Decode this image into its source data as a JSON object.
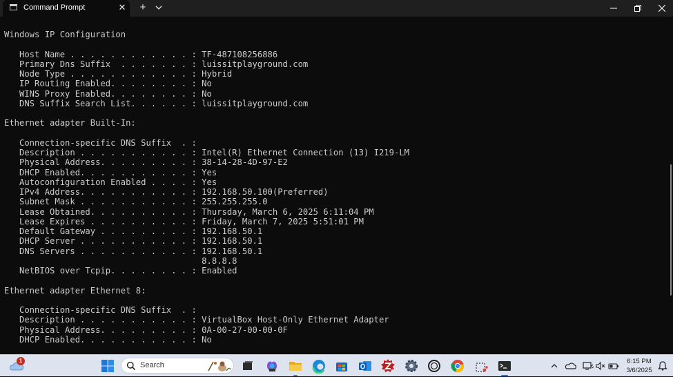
{
  "window": {
    "tab_title": "Command Prompt",
    "tab_close_glyph": "✕",
    "new_tab_glyph": "+",
    "dropdown_icon": "chevron-down-icon",
    "controls": [
      "minimize-icon",
      "restore-icon",
      "close-icon"
    ]
  },
  "terminal": {
    "lines": [
      "Windows IP Configuration",
      "",
      "   Host Name . . . . . . . . . . . . : TF-487108256886",
      "   Primary Dns Suffix  . . . . . . . : luissitplayground.com",
      "   Node Type . . . . . . . . . . . . : Hybrid",
      "   IP Routing Enabled. . . . . . . . : No",
      "   WINS Proxy Enabled. . . . . . . . : No",
      "   DNS Suffix Search List. . . . . . : luissitplayground.com",
      "",
      "Ethernet adapter Built-In:",
      "",
      "   Connection-specific DNS Suffix  . :",
      "   Description . . . . . . . . . . . : Intel(R) Ethernet Connection (13) I219-LM",
      "   Physical Address. . . . . . . . . : 38-14-28-4D-97-E2",
      "   DHCP Enabled. . . . . . . . . . . : Yes",
      "   Autoconfiguration Enabled . . . . : Yes",
      "   IPv4 Address. . . . . . . . . . . : 192.168.50.100(Preferred)",
      "   Subnet Mask . . . . . . . . . . . : 255.255.255.0",
      "   Lease Obtained. . . . . . . . . . : Thursday, March 6, 2025 6:11:04 PM",
      "   Lease Expires . . . . . . . . . . : Friday, March 7, 2025 5:51:01 PM",
      "   Default Gateway . . . . . . . . . : 192.168.50.1",
      "   DHCP Server . . . . . . . . . . . : 192.168.50.1",
      "   DNS Servers . . . . . . . . . . . : 192.168.50.1",
      "                                       8.8.8.8",
      "   NetBIOS over Tcpip. . . . . . . . : Enabled",
      "",
      "Ethernet adapter Ethernet 8:",
      "",
      "   Connection-specific DNS Suffix  . :",
      "   Description . . . . . . . . . . . : VirtualBox Host-Only Ethernet Adapter",
      "   Physical Address. . . . . . . . . : 0A-00-27-00-00-0F",
      "   DHCP Enabled. . . . . . . . . . . : No"
    ]
  },
  "taskbar": {
    "weather_icon": "weather-icon",
    "notification_count": "1",
    "search_placeholder": "Search",
    "pinned_apps": [
      {
        "name": "start-icon"
      },
      {
        "name": "task-view-icon"
      },
      {
        "name": "copilot-m365-icon"
      },
      {
        "name": "file-explorer-icon"
      },
      {
        "name": "edge-icon"
      },
      {
        "name": "store-icon"
      },
      {
        "name": "outlook-icon"
      },
      {
        "name": "filezilla-icon"
      },
      {
        "name": "settings-icon"
      },
      {
        "name": "app-ring-icon"
      },
      {
        "name": "chrome-icon"
      },
      {
        "name": "snipping-tool-icon"
      },
      {
        "name": "terminal-icon"
      }
    ],
    "tray_icons": [
      "chevron-up-icon",
      "onedrive-icon",
      "network-icon",
      "volume-muted-icon",
      "battery-icon"
    ],
    "clock_time": "6:15 PM",
    "clock_date": "3/6/2025",
    "notification_icon": "notification-bell-icon"
  },
  "colors": {
    "terminal_bg": "#0c0c0c",
    "terminal_fg": "#cccccc",
    "titlebar_bg": "#1f1f1f",
    "taskbar_bg": "#dde4ef",
    "badge": "#c42b1c"
  }
}
